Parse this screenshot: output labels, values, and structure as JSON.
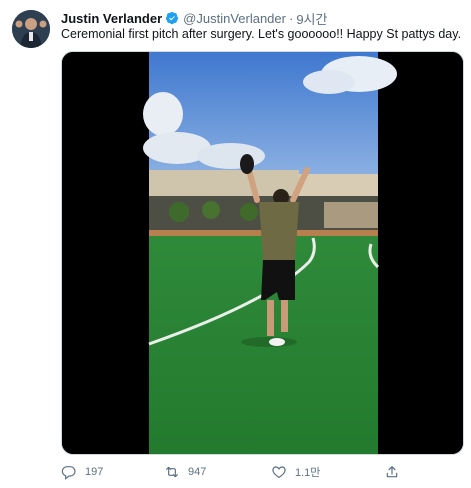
{
  "author": {
    "name": "Justin Verlander",
    "handle": "@JustinVerlander",
    "separator": "·",
    "time": "9시간",
    "verified": true,
    "avatar": "avatar-photo"
  },
  "tweet": {
    "text": "Ceremonial first pitch after surgery.  Let's goooooo!!  Happy St pattys day."
  },
  "media": {
    "type": "video",
    "description_icon": "video-thumbnail"
  },
  "actions": {
    "reply": {
      "icon": "reply-icon",
      "count": "197"
    },
    "retweet": {
      "icon": "retweet-icon",
      "count": "947"
    },
    "like": {
      "icon": "heart-icon",
      "count": "1.1만"
    },
    "share": {
      "icon": "share-icon"
    }
  },
  "colors": {
    "verified": "#1da1f2",
    "secondary_text": "#5b7083",
    "primary_text": "#0f1419"
  }
}
